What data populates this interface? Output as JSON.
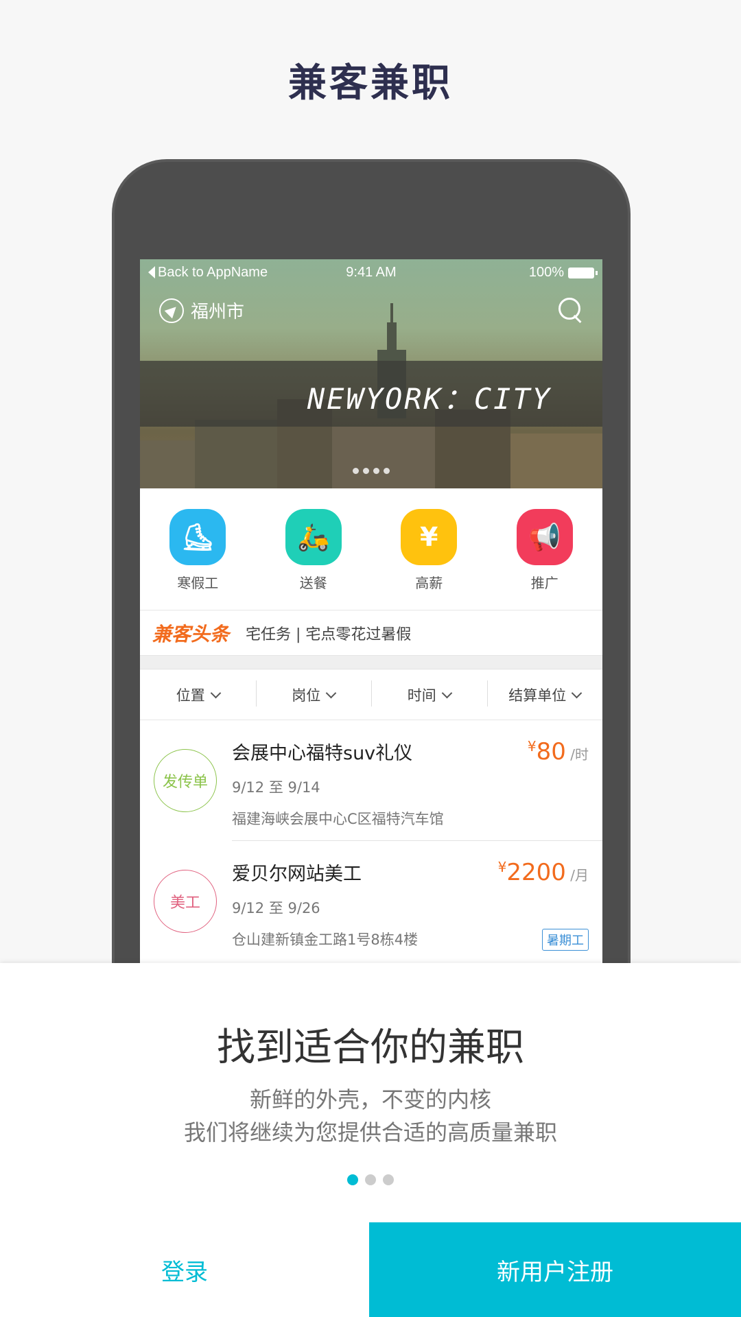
{
  "app": {
    "title": "兼客兼职"
  },
  "status_bar": {
    "back": "Back to AppName",
    "time": "9:41 AM",
    "battery": "100%"
  },
  "banner": {
    "city": "福州市",
    "caption": "NEWYORK：CITY"
  },
  "categories": [
    {
      "label": "寒假工",
      "icon": "skate-icon",
      "color": "#2bb8f0"
    },
    {
      "label": "送餐",
      "icon": "scooter-icon",
      "color": "#1fcfb7"
    },
    {
      "label": "高薪",
      "icon": "money-bag-icon",
      "color": "#ffc20e"
    },
    {
      "label": "推广",
      "icon": "megaphone-icon",
      "color": "#f23c5b"
    }
  ],
  "headline": {
    "logo": "兼客头条",
    "text": "宅任务 | 宅点零花过暑假"
  },
  "filters": [
    "位置",
    "岗位",
    "时间",
    "结算单位"
  ],
  "jobs": [
    {
      "badge": "发传单",
      "badge_color": "#8bc34a",
      "title": "会展中心福特suv礼仪",
      "yen": "¥",
      "amount": "80",
      "unit": "/时",
      "date": "9/12 至 9/14",
      "address": "福建海峡会展中心C区福特汽车馆",
      "tag": ""
    },
    {
      "badge": "美工",
      "badge_color": "#e0607e",
      "title": "爱贝尔网站美工",
      "yen": "¥",
      "amount": "2200",
      "unit": "/月",
      "date": "9/12 至 9/26",
      "address": "仓山建新镇金工路1号8栋4楼",
      "tag": "暑期工"
    }
  ],
  "intro": {
    "headline": "找到适合你的兼职",
    "line1": "新鲜的外壳，不变的内核",
    "line2": "我们将继续为您提供合适的高质量兼职"
  },
  "pager": {
    "pages": 3,
    "active": 1
  },
  "actions": {
    "login": "登录",
    "register": "新用户注册"
  },
  "colors": {
    "accent": "#00bcd4",
    "price": "#f26b1d",
    "title": "#2e2f4f"
  }
}
